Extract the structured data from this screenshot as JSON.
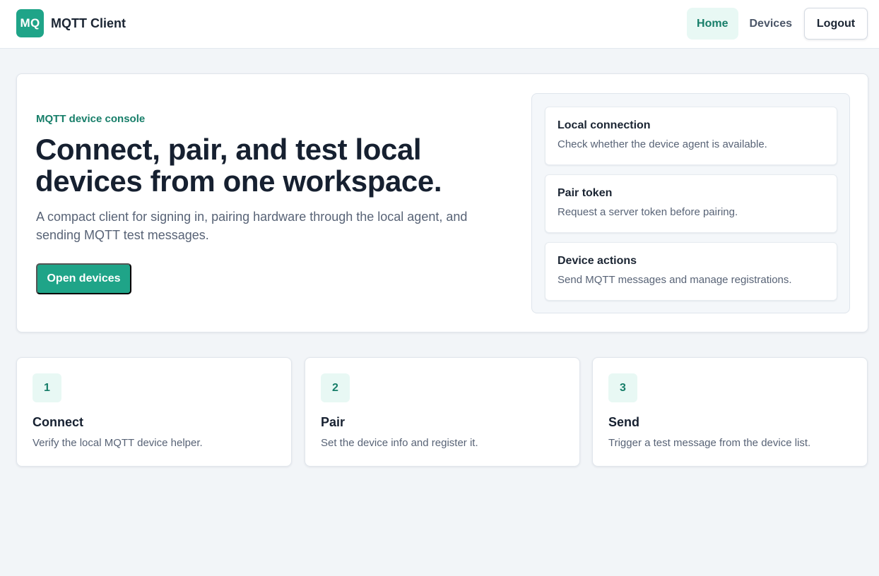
{
  "header": {
    "brand_mark": "MQ",
    "brand_name": "MQTT Client",
    "nav": [
      {
        "label": "Home",
        "active": true
      },
      {
        "label": "Devices",
        "active": false
      }
    ],
    "logout_label": "Logout"
  },
  "hero": {
    "eyebrow": "MQTT device console",
    "headline": "Connect, pair, and test local devices from one workspace.",
    "lede": "A compact client for signing in, pairing hardware through the local agent, and sending MQTT test messages.",
    "cta_label": "Open devices",
    "status_items": [
      {
        "title": "Local connection",
        "desc": "Check whether the device agent is available."
      },
      {
        "title": "Pair token",
        "desc": "Request a server token before pairing."
      },
      {
        "title": "Device actions",
        "desc": "Send MQTT messages and manage registrations."
      }
    ]
  },
  "steps": [
    {
      "num": "1",
      "title": "Connect",
      "desc": "Verify the local MQTT device helper."
    },
    {
      "num": "2",
      "title": "Pair",
      "desc": "Set the device info and register it."
    },
    {
      "num": "3",
      "title": "Send",
      "desc": "Trigger a test message from the device list."
    }
  ],
  "colors": {
    "accent": "#1fa488",
    "accent_text": "#177e69",
    "accent_soft": "#e8f8f4",
    "background": "#f2f5f8"
  }
}
